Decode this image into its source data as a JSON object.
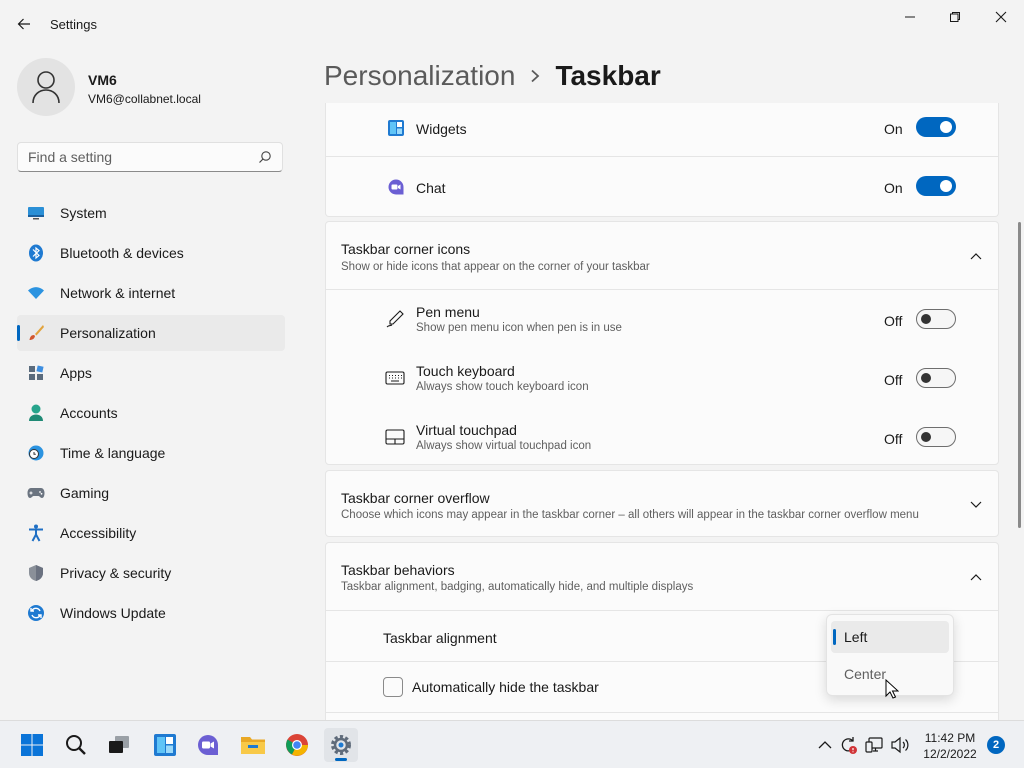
{
  "window": {
    "title": "Settings"
  },
  "profile": {
    "name": "VM6",
    "email": "VM6@collabnet.local"
  },
  "search": {
    "placeholder": "Find a setting"
  },
  "nav": {
    "items": [
      {
        "label": "System",
        "icon": "monitor-icon"
      },
      {
        "label": "Bluetooth & devices",
        "icon": "bluetooth-icon"
      },
      {
        "label": "Network & internet",
        "icon": "wifi-icon"
      },
      {
        "label": "Personalization",
        "icon": "brush-icon",
        "active": true
      },
      {
        "label": "Apps",
        "icon": "apps-icon"
      },
      {
        "label": "Accounts",
        "icon": "person-icon"
      },
      {
        "label": "Time & language",
        "icon": "globe-clock-icon"
      },
      {
        "label": "Gaming",
        "icon": "gamepad-icon"
      },
      {
        "label": "Accessibility",
        "icon": "accessibility-icon"
      },
      {
        "label": "Privacy & security",
        "icon": "shield-icon"
      },
      {
        "label": "Windows Update",
        "icon": "update-icon"
      }
    ]
  },
  "breadcrumb": {
    "parent": "Personalization",
    "current": "Taskbar"
  },
  "taskbar_items": {
    "widgets": {
      "label": "Widgets",
      "state": "On"
    },
    "chat": {
      "label": "Chat",
      "state": "On"
    }
  },
  "corner_icons": {
    "title": "Taskbar corner icons",
    "subtitle": "Show or hide icons that appear on the corner of your taskbar",
    "items": [
      {
        "title": "Pen menu",
        "subtitle": "Show pen menu icon when pen is in use",
        "state": "Off"
      },
      {
        "title": "Touch keyboard",
        "subtitle": "Always show touch keyboard icon",
        "state": "Off"
      },
      {
        "title": "Virtual touchpad",
        "subtitle": "Always show virtual touchpad icon",
        "state": "Off"
      }
    ]
  },
  "corner_overflow": {
    "title": "Taskbar corner overflow",
    "subtitle": "Choose which icons may appear in the taskbar corner – all others will appear in the taskbar corner overflow menu"
  },
  "behaviors": {
    "title": "Taskbar behaviors",
    "subtitle": "Taskbar alignment, badging, automatically hide, and multiple displays",
    "alignment_label": "Taskbar alignment",
    "autohide_label": "Automatically hide the taskbar",
    "alignment_options": [
      "Left",
      "Center"
    ],
    "alignment_selected": "Left"
  },
  "system_tray": {
    "time": "11:42 PM",
    "date": "12/2/2022",
    "notification_count": "2"
  },
  "colors": {
    "accent": "#0067c0",
    "background": "#f3f3f3",
    "card": "#fbfbfb"
  }
}
